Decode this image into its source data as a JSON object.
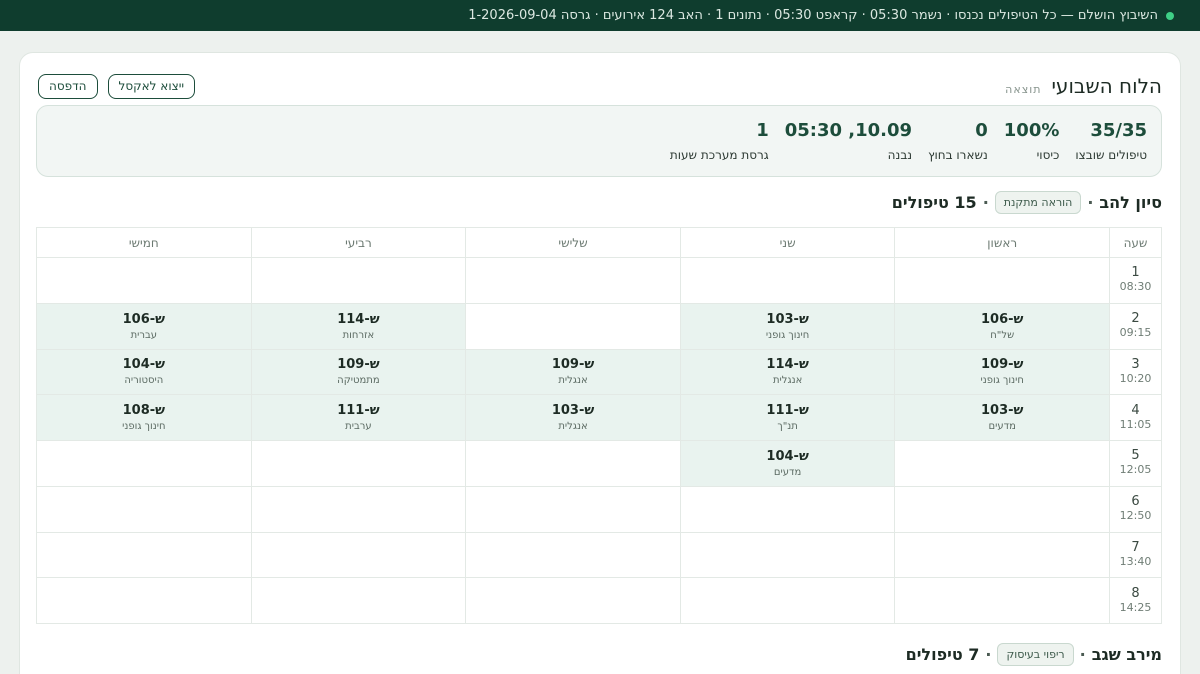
{
  "topbar": {
    "status_text": "השיבוץ הושלם — כל הטיפולים נכנסו · נשמר 05:30 · קראפט 05:30 · נתונים 1 · האב 124 אירועים · גרסה 1-2026-09-04"
  },
  "header": {
    "eyebrow": "תוצאה",
    "title": "הלוח השבועי",
    "export_label": "ייצוא לאקסל",
    "print_label": "הדפסה"
  },
  "stats": [
    {
      "value": "35/35",
      "label": "טיפולים שובצו"
    },
    {
      "value": "100%",
      "label": "כיסוי"
    },
    {
      "value": "0",
      "label": "נשארו בחוץ"
    },
    {
      "value": "10.09, 05:30",
      "label": "נבנה"
    },
    {
      "value": "1",
      "label": "גרסת מערכת שעות"
    }
  ],
  "teacher1": {
    "name": "סיון להב",
    "tag": "הוראה מתקנת",
    "count": "15 טיפולים"
  },
  "teacher2": {
    "name": "מירב שגב",
    "tag": "ריפוי בעיסוק",
    "count": "7 טיפולים"
  },
  "schedule": {
    "hour_header": "שעה",
    "days": [
      "ראשון",
      "שני",
      "שלישי",
      "רביעי",
      "חמישי"
    ],
    "rows": [
      {
        "num": "1",
        "time": "08:30",
        "cells": [
          null,
          null,
          null,
          null,
          null
        ]
      },
      {
        "num": "2",
        "time": "09:15",
        "cells": [
          {
            "room": "ש-106",
            "subject": "של\"ח"
          },
          {
            "room": "ש-103",
            "subject": "חינוך גופני"
          },
          null,
          {
            "room": "ש-114",
            "subject": "אזרחות"
          },
          {
            "room": "ש-106",
            "subject": "עברית"
          }
        ]
      },
      {
        "num": "3",
        "time": "10:20",
        "cells": [
          {
            "room": "ש-109",
            "subject": "חינוך גופני"
          },
          {
            "room": "ש-114",
            "subject": "אנגלית"
          },
          {
            "room": "ש-109",
            "subject": "אנגלית"
          },
          {
            "room": "ש-109",
            "subject": "מתמטיקה"
          },
          {
            "room": "ש-104",
            "subject": "היסטוריה"
          }
        ]
      },
      {
        "num": "4",
        "time": "11:05",
        "cells": [
          {
            "room": "ש-103",
            "subject": "מדעים"
          },
          {
            "room": "ש-111",
            "subject": "תנ\"ך"
          },
          {
            "room": "ש-103",
            "subject": "אנגלית"
          },
          {
            "room": "ש-111",
            "subject": "ערבית"
          },
          {
            "room": "ש-108",
            "subject": "חינוך גופני"
          }
        ]
      },
      {
        "num": "5",
        "time": "12:05",
        "cells": [
          null,
          {
            "room": "ש-104",
            "subject": "מדעים"
          },
          null,
          null,
          null
        ]
      },
      {
        "num": "6",
        "time": "12:50",
        "cells": [
          null,
          null,
          null,
          null,
          null
        ]
      },
      {
        "num": "7",
        "time": "13:40",
        "cells": [
          null,
          null,
          null,
          null,
          null
        ]
      },
      {
        "num": "8",
        "time": "14:25",
        "cells": [
          null,
          null,
          null,
          null,
          null
        ]
      }
    ]
  }
}
